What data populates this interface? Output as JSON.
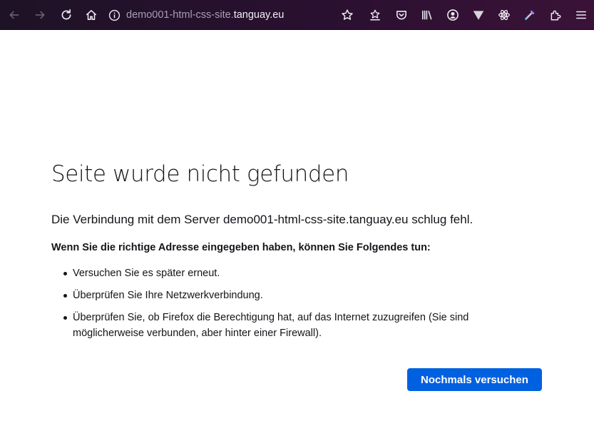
{
  "toolbar": {
    "icons": [
      "back-arrow-icon",
      "forward-arrow-icon",
      "reload-icon",
      "home-icon",
      "info-icon",
      "star-icon",
      "save-to-pocket-icon",
      "pocket-icon",
      "library-icon",
      "vue-devtools-icon",
      "react-devtools-icon",
      "color-picker-icon",
      "extensions-icon",
      "menu-icon"
    ]
  },
  "url": {
    "prefix": "demo001-html-css-site.",
    "host": "tanguay.eu"
  },
  "error": {
    "title": "Seite wurde nicht gefunden",
    "description": "Die Verbindung mit dem Server demo001-html-css-site.tanguay.eu schlug fehl.",
    "subtitle": "Wenn Sie die richtige Adresse eingegeben haben, können Sie Folgendes tun:",
    "tips": [
      "Versuchen Sie es später erneut.",
      "Überprüfen Sie Ihre Netzwerkverbindung.",
      "Überprüfen Sie, ob Firefox die Berechtigung hat, auf das Internet zuzugreifen (Sie sind möglicherweise verbunden, aber hinter einer Firewall)."
    ],
    "retry_label": "Nochmals versuchen"
  },
  "colors": {
    "button": "#0061e0",
    "toolbar": "#2a1030"
  }
}
